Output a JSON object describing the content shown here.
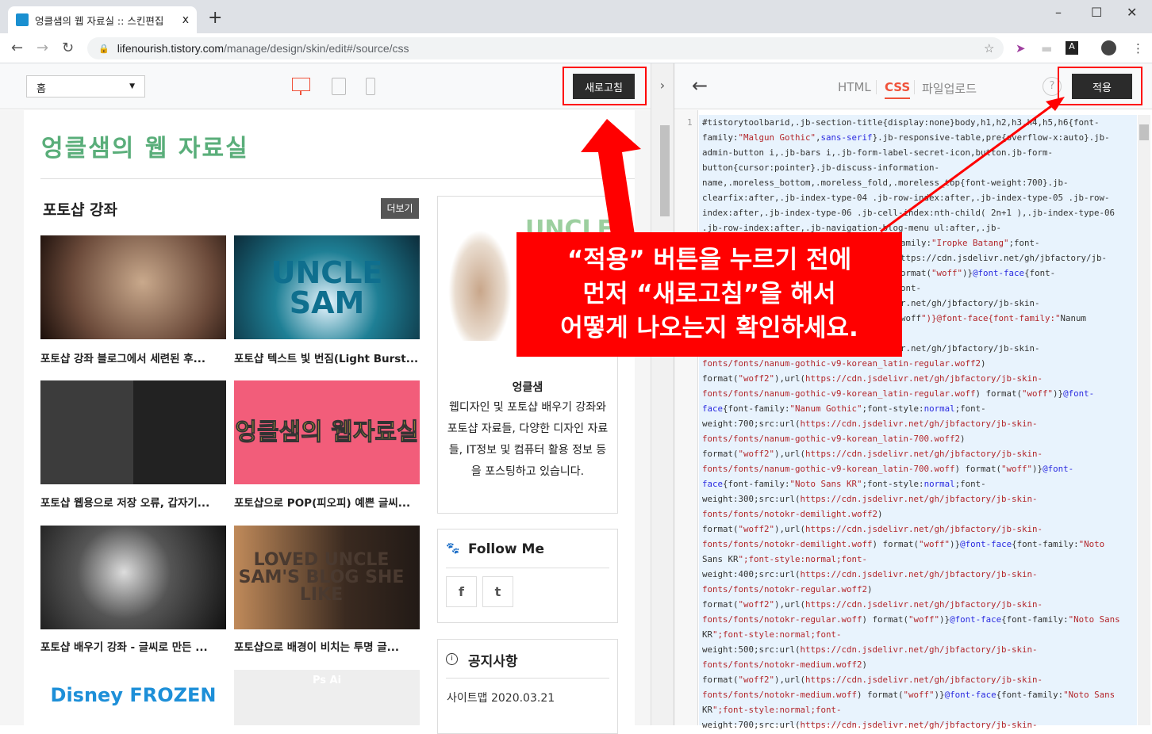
{
  "browser": {
    "tab_title": "엉클샘의 웹 자료실 :: 스킨편집",
    "tab_close": "x",
    "new_tab": "+",
    "favicon_text": "SAM",
    "url_host": "lifenourish.tistory.com",
    "url_path": "/manage/design/skin/edit#/source/css",
    "win_min": "–",
    "win_max": "☐",
    "win_close": "✕"
  },
  "editor": {
    "page_select": "홈",
    "refresh_label": "새로고침",
    "collapse": "›",
    "back": "←",
    "tabs": [
      {
        "label": "HTML"
      },
      {
        "label": "CSS",
        "active": true
      },
      {
        "label": "파일업로드"
      }
    ],
    "help": "?",
    "apply_label": "적용",
    "accent": "#f0523a"
  },
  "preview": {
    "blog_title": "엉클샘의 웹 자료실",
    "section_title": "포토샵 강좌",
    "more_label": "더보기",
    "posts": [
      {
        "caption": "포토샵 강좌 블로그에서 세련된 후...",
        "thumb_text": ""
      },
      {
        "caption": "포토샵 텍스트 빛 번짐(Light Burst...",
        "thumb_text": "UNCLE SAM"
      },
      {
        "caption": "포토샵 웹용으로 저장 오류, 갑자기...",
        "thumb_text": ""
      },
      {
        "caption": "포토샵으로 POP(피오피) 예쁜 글씨...",
        "thumb_text": "엉클샘의 웹자료실"
      },
      {
        "caption": "포토샵 배우기 강좌 - 글씨로 만든 ...",
        "thumb_text": ""
      },
      {
        "caption": "포토샵으로 배경이 비치는 투명 글...",
        "thumb_text": "LOVED UNCLE SAM'S BLOG SHE LIKE"
      },
      {
        "caption": "",
        "thumb_text": "Disney FROZEN"
      },
      {
        "caption": "",
        "thumb_text": "Ps  Ai"
      }
    ],
    "profile": {
      "logo_text": "UNCLE",
      "name": "엉클샘",
      "desc": "웹디자인 및 포토샵 배우기 강좌와 포토샵 자료들, 다양한 디자인 자료들, IT정보 및 컴퓨터 활용 정보 등을 포스팅하고 있습니다."
    },
    "follow": {
      "title": "Follow Me",
      "facebook": "f",
      "twitter": "t"
    },
    "notice": {
      "title": "공지사항",
      "items": [
        "사이트맵 2020.03.21"
      ]
    }
  },
  "code": {
    "line_number": "1",
    "lines": [
      "#tistorytoolbarid,.jb-section-title{display:none}body,h1,h2,h3,h4,h5,h6{font-",
      "family:\"Malgun Gothic\",sans-serif}.jb-responsive-table,pre{overflow-x:auto}.jb-",
      "admin-button i,.jb-bars i,.jb-form-label-secret-icon,button.jb-form-",
      "button{cursor:pointer}.jb-discuss-information-",
      "name,.moreless_bottom,.moreless_fold,.moreless_top{font-weight:700}.jb-",
      "clearfix:after,.jb-index-type-04 .jb-row-index:after,.jb-index-type-05 .jb-row-",
      "index:after,.jb-index-type-06 .jb-cell-index:nth-child( 2n+1 ),.jb-index-type-06",
      ".jb-row-index:after,.jb-navigation-blog-menu ul:after,.jb-",
      "amily:\"Iropke Batang\";font-",
      "ttps://cdn.jsdelivr.net/gh/jbfactory/jb-",
      "ormat(\"woff\")}@font-face{font-",
      "ont-",
      "r.net/gh/jbfactory/jb-skin-",
      "woff\")}@font-face{font-family:\"Nanum",
      "",
      "r.net/gh/jbfactory/jb-skin-",
      "fonts/fonts/nanum-gothic-v9-korean_latin-regular.woff2)",
      "format(\"woff2\"),url(https://cdn.jsdelivr.net/gh/jbfactory/jb-skin-",
      "fonts/fonts/nanum-gothic-v9-korean_latin-regular.woff) format(\"woff\")}@font-",
      "face{font-family:\"Nanum Gothic\";font-style:normal;font-",
      "weight:700;src:url(https://cdn.jsdelivr.net/gh/jbfactory/jb-skin-",
      "fonts/fonts/nanum-gothic-v9-korean_latin-700.woff2)",
      "format(\"woff2\"),url(https://cdn.jsdelivr.net/gh/jbfactory/jb-skin-",
      "fonts/fonts/nanum-gothic-v9-korean_latin-700.woff) format(\"woff\")}@font-",
      "face{font-family:\"Noto Sans KR\";font-style:normal;font-",
      "weight:300;src:url(https://cdn.jsdelivr.net/gh/jbfactory/jb-skin-",
      "fonts/fonts/notokr-demilight.woff2)",
      "format(\"woff2\"),url(https://cdn.jsdelivr.net/gh/jbfactory/jb-skin-",
      "fonts/fonts/notokr-demilight.woff) format(\"woff\")}@font-face{font-family:\"Noto",
      "Sans KR\";font-style:normal;font-",
      "weight:400;src:url(https://cdn.jsdelivr.net/gh/jbfactory/jb-skin-",
      "fonts/fonts/notokr-regular.woff2)",
      "format(\"woff2\"),url(https://cdn.jsdelivr.net/gh/jbfactory/jb-skin-",
      "fonts/fonts/notokr-regular.woff) format(\"woff\")}@font-face{font-family:\"Noto Sans",
      "KR\";font-style:normal;font-",
      "weight:500;src:url(https://cdn.jsdelivr.net/gh/jbfactory/jb-skin-",
      "fonts/fonts/notokr-medium.woff2)",
      "format(\"woff2\"),url(https://cdn.jsdelivr.net/gh/jbfactory/jb-skin-",
      "fonts/fonts/notokr-medium.woff) format(\"woff\")}@font-face{font-family:\"Noto Sans",
      "KR\";font-style:normal;font-",
      "weight:700;src:url(https://cdn.jsdelivr.net/gh/jbfactory/jb-skin-"
    ],
    "partial_lines": [
      8,
      9,
      10,
      11,
      12,
      13,
      14,
      15
    ]
  },
  "annotation": {
    "lines": [
      "“적용” 버튼을 누르기 전에",
      "먼저 “새로고침”을 해서",
      "어떻게 나오는지 확인하세요."
    ],
    "color": "#ff0000"
  }
}
